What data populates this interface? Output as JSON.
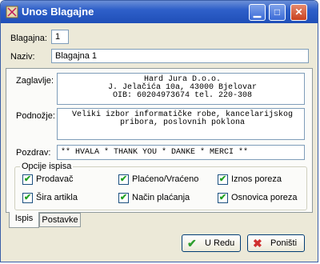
{
  "window": {
    "title": "Unos Blagajne"
  },
  "fields": {
    "blagajna_label": "Blagajna:",
    "blagajna_value": "1",
    "naziv_label": "Naziv:",
    "naziv_value": "Blagajna 1",
    "zaglavlje_label": "Zaglavlje:",
    "zaglavlje_lines": [
      "Hard Jura D.o.o.",
      "J. Jelačića 10a, 43000 Bjelovar",
      "OIB: 60204973674 tel. 220-308"
    ],
    "podnozje_label": "Podnožje:",
    "podnozje_lines": [
      "Veliki izbor informatičke robe, kancelarijskog",
      "pribora, poslovnih poklona"
    ],
    "pozdrav_label": "Pozdrav:",
    "pozdrav_value": "** HVALA * THANK YOU * DANKE * MERCI **"
  },
  "options": {
    "group_title": "Opcije ispisa",
    "items": [
      {
        "label": "Prodavač",
        "checked": true
      },
      {
        "label": "Plaćeno/Vraćeno",
        "checked": true
      },
      {
        "label": "Iznos poreza",
        "checked": true
      },
      {
        "label": "Šira artikla",
        "checked": true
      },
      {
        "label": "Način plaćanja",
        "checked": true
      },
      {
        "label": "Osnovica poreza",
        "checked": true
      }
    ]
  },
  "tabs": [
    {
      "label": "Ispis",
      "active": true
    },
    {
      "label": "Postavke",
      "active": false
    }
  ],
  "buttons": {
    "ok_label": "U Redu",
    "cancel_label": "Poništi"
  },
  "colors": {
    "ok_icon": "#2e9e2e",
    "cancel_icon": "#d03030",
    "titlebar": "#2e5fc9"
  }
}
